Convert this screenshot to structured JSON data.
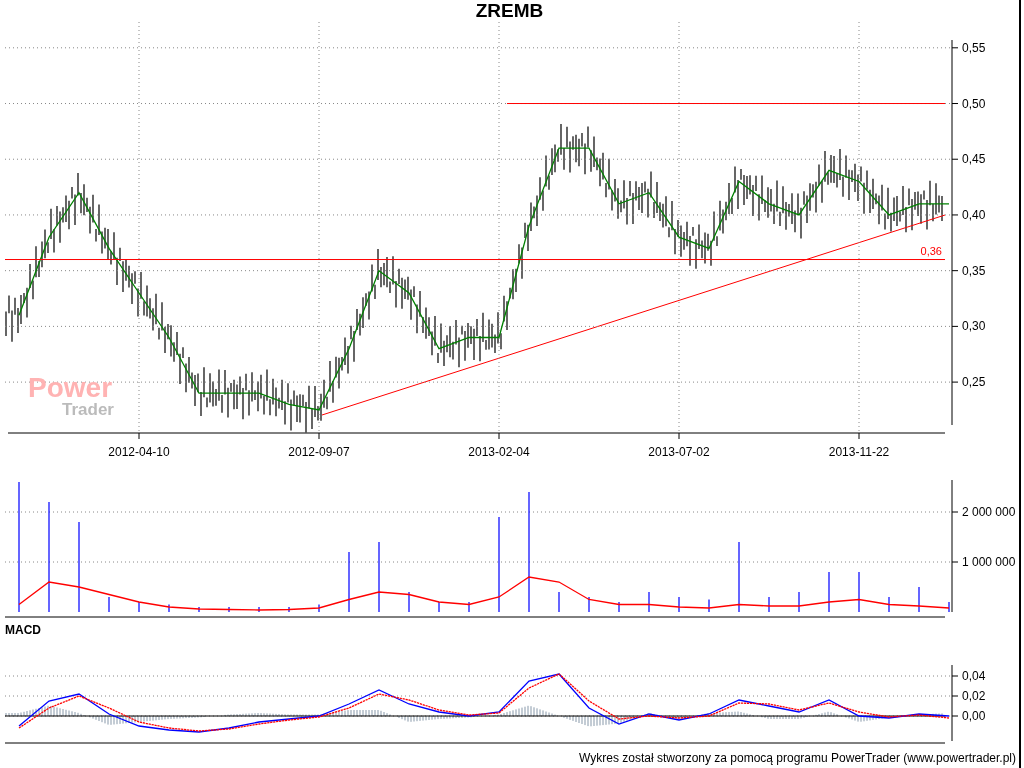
{
  "title": "ZREMB",
  "price_panel": {
    "watermark": [
      "Power",
      "Trader"
    ],
    "chart_data": {
      "type": "line",
      "ylim": [
        0.2115,
        0.557
      ],
      "categories": [
        null,
        null,
        null,
        null,
        "2012-04-10",
        null,
        null,
        null,
        null,
        null,
        "2012-09-07",
        null,
        null,
        null,
        null,
        null,
        "2013-02-04",
        null,
        null,
        null,
        null,
        null,
        "2013-07-02",
        null,
        null,
        null,
        null,
        null,
        "2013-11-22",
        null,
        null,
        null
      ],
      "yticks": [
        {
          "value": 0.25,
          "label": "0,25"
        },
        {
          "value": 0.3,
          "label": "0,30"
        },
        {
          "value": 0.35,
          "label": "0,35"
        },
        {
          "value": 0.4,
          "label": "0,40"
        },
        {
          "value": 0.45,
          "label": "0,45"
        },
        {
          "value": 0.5,
          "label": "0,50"
        },
        {
          "value": 0.55,
          "label": "0,55"
        }
      ],
      "series": [
        {
          "color": "#008000",
          "values": [
            0.31,
            0.38,
            0.42,
            0.37,
            0.33,
            0.29,
            0.24,
            0.24,
            0.24,
            0.23,
            0.225,
            0.28,
            0.35,
            0.33,
            0.28,
            0.29,
            0.29,
            0.39,
            0.46,
            0.46,
            0.41,
            0.42,
            0.38,
            0.37,
            0.43,
            0.41,
            0.4,
            0.44,
            0.43,
            0.4,
            0.41,
            0.41
          ]
        }
      ],
      "ref_lines": [
        {
          "axis": "y",
          "value": 0.36,
          "label": "0,36"
        },
        {
          "axis": "y",
          "value": 0.5
        }
      ],
      "grid": true
    }
  },
  "volume_panel": {
    "chart_data": {
      "type": "bar",
      "ylim": [
        0,
        2640000
      ],
      "grid": true,
      "categories": [
        null,
        null,
        null,
        null,
        null,
        null,
        null,
        null,
        null,
        null,
        null,
        null,
        null,
        null,
        null,
        null,
        null,
        null,
        null,
        null,
        null,
        null,
        null,
        null,
        null,
        null,
        null,
        null,
        null,
        null,
        null,
        null
      ],
      "yticks": [
        {
          "value": 1000000,
          "label": "1 000 000"
        },
        {
          "value": 2000000,
          "label": "2 000 000"
        }
      ],
      "series": [
        {
          "color": "#0000ff",
          "values": [
            2600000,
            2200000,
            1800000,
            300000,
            200000,
            150000,
            100000,
            100000,
            100000,
            100000,
            150000,
            1200000,
            1400000,
            400000,
            200000,
            200000,
            1900000,
            2400000,
            400000,
            300000,
            200000,
            400000,
            300000,
            250000,
            1400000,
            300000,
            400000,
            800000,
            800000,
            300000,
            500000,
            200000
          ]
        },
        {
          "type": "line",
          "color": "#ff0000",
          "values": [
            150000,
            600000,
            500000,
            350000,
            200000,
            100000,
            60000,
            50000,
            40000,
            50000,
            80000,
            250000,
            400000,
            350000,
            200000,
            150000,
            300000,
            700000,
            600000,
            250000,
            150000,
            150000,
            100000,
            80000,
            150000,
            120000,
            120000,
            200000,
            250000,
            150000,
            120000,
            80000
          ]
        }
      ]
    }
  },
  "macd_panel": {
    "label": "MACD",
    "chart_data": {
      "type": "line",
      "ylim": [
        -0.025,
        0.051
      ],
      "grid": true,
      "categories": [
        null,
        null,
        null,
        null,
        null,
        null,
        null,
        null,
        null,
        null,
        null,
        null,
        null,
        null,
        null,
        null,
        null,
        null,
        null,
        null,
        null,
        null,
        null,
        null,
        null,
        null,
        null,
        null,
        null,
        null,
        null,
        null
      ],
      "yticks": [
        {
          "value": 0,
          "label": "0,00"
        },
        {
          "value": 0.02,
          "label": "0,02"
        },
        {
          "value": 0.04,
          "label": "0,04"
        }
      ],
      "series": [
        {
          "color": "#0000ff",
          "values": [
            -0.01,
            0.015,
            0.022,
            0.002,
            -0.01,
            -0.014,
            -0.016,
            -0.012,
            -0.006,
            -0.003,
            0.0,
            0.012,
            0.026,
            0.012,
            0.004,
            0.0,
            0.004,
            0.035,
            0.042,
            0.008,
            -0.008,
            0.002,
            -0.004,
            0.002,
            0.016,
            0.01,
            0.004,
            0.016,
            0.0,
            -0.002,
            0.002,
            0.0
          ]
        },
        {
          "color": "#ff0000",
          "line_style": "dashed",
          "values": [
            -0.012,
            0.008,
            0.02,
            0.008,
            -0.006,
            -0.012,
            -0.015,
            -0.013,
            -0.008,
            -0.004,
            -0.001,
            0.008,
            0.022,
            0.016,
            0.006,
            0.001,
            0.003,
            0.028,
            0.042,
            0.015,
            -0.003,
            0.0,
            -0.002,
            0.0,
            0.013,
            0.012,
            0.006,
            0.013,
            0.004,
            -0.001,
            0.001,
            -0.002
          ]
        }
      ]
    }
  },
  "footer": "Wykres został stworzony za pomocą programu PowerTrader (www.powertrader.pl)"
}
